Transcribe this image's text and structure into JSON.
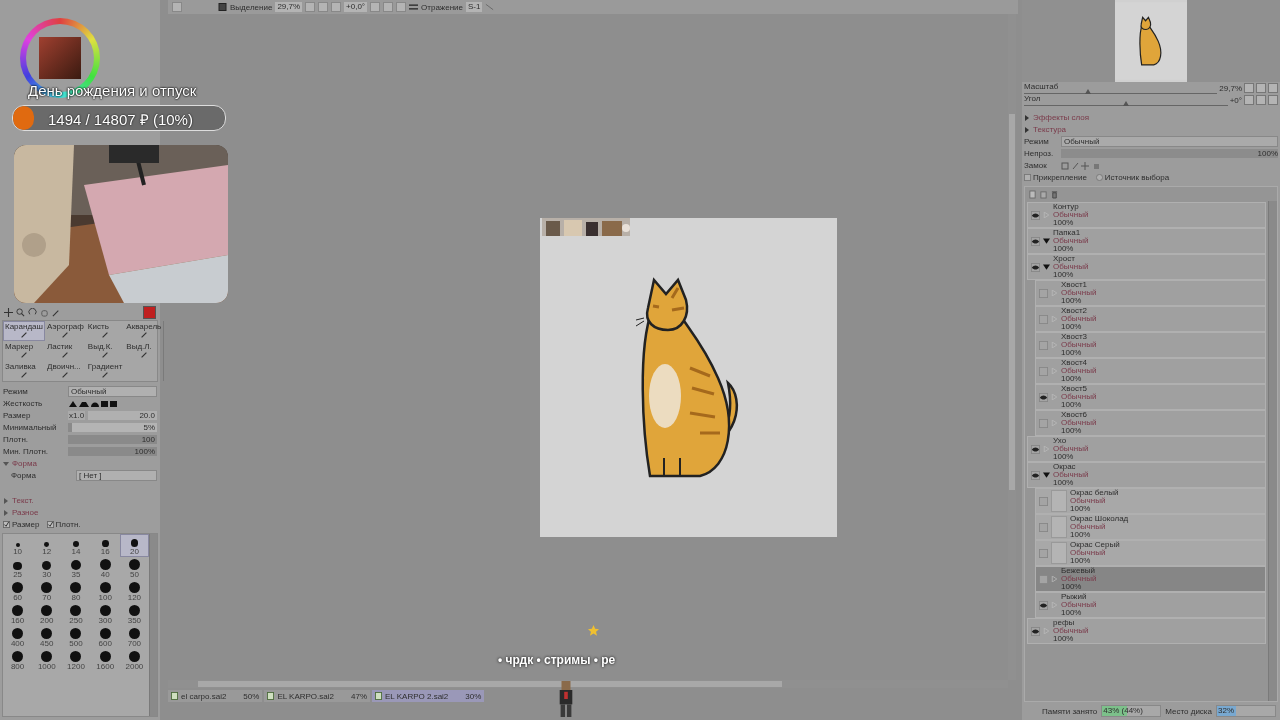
{
  "overlay": {
    "goal_title": "День рождения и отпуск",
    "goal_amount": "1494 / 14807 ₽ (10%)",
    "goal_progress": {
      "level": 0.1
    },
    "caption": "• чрдк • стримы • ре"
  },
  "toolbar": {
    "selection_checked": true,
    "selection_label": "Выделение",
    "zoom": "29,7%",
    "angle": "+0,0°",
    "mirror_label": "Отражение",
    "stabilizer": "S-1"
  },
  "tools": [
    {
      "label": "Карандаш",
      "selected": true
    },
    {
      "label": "Аэрограф",
      "selected": false
    },
    {
      "label": "Кисть",
      "selected": false
    },
    {
      "label": "Акварель",
      "selected": false
    },
    {
      "label": "Маркер",
      "selected": false
    },
    {
      "label": "Ластик",
      "selected": false
    },
    {
      "label": "Выд.К.",
      "selected": false
    },
    {
      "label": "Выд.Л.",
      "selected": false
    },
    {
      "label": "Заливка",
      "selected": false
    },
    {
      "label": "Двоичн...",
      "selected": false
    },
    {
      "label": "Градиент",
      "selected": false
    }
  ],
  "brush_settings": {
    "mode_label": "Режим",
    "mode": "Обычный",
    "hardness_label": "Жесткость",
    "size_label": "Размер",
    "size_multiplier": "x1.0",
    "size": "20.0",
    "min_size_label": "Минимальный",
    "min_size": {
      "reading": "5%",
      "level": 0.05
    },
    "density_label": "Плотн.",
    "density": {
      "reading": "100",
      "level": 1
    },
    "min_density_label": "Мин. Плотн.",
    "min_density": {
      "reading": "100%",
      "level": 1
    },
    "shape_section": "Форма",
    "shape_label": "Форма",
    "shape": "[ Нет ]",
    "texture_section": "Текст.",
    "misc_section": "Разное",
    "checks": [
      {
        "label": "Размер",
        "checked": true
      },
      {
        "label": "Плотн.",
        "checked": true
      }
    ]
  },
  "brush_sizes": [
    {
      "label": "10",
      "selected": false
    },
    {
      "label": "12",
      "selected": false
    },
    {
      "label": "14",
      "selected": false
    },
    {
      "label": "16",
      "selected": false
    },
    {
      "label": "20",
      "selected": true
    },
    {
      "label": "25",
      "selected": false
    },
    {
      "label": "30",
      "selected": false
    },
    {
      "label": "35",
      "selected": false
    },
    {
      "label": "40",
      "selected": false
    },
    {
      "label": "50",
      "selected": false
    },
    {
      "label": "60",
      "selected": false
    },
    {
      "label": "70",
      "selected": false
    },
    {
      "label": "80",
      "selected": false
    },
    {
      "label": "100",
      "selected": false
    },
    {
      "label": "120",
      "selected": false
    },
    {
      "label": "160",
      "selected": false
    },
    {
      "label": "200",
      "selected": false
    },
    {
      "label": "250",
      "selected": false
    },
    {
      "label": "300",
      "selected": false
    },
    {
      "label": "350",
      "selected": false
    },
    {
      "label": "400",
      "selected": false
    },
    {
      "label": "450",
      "selected": false
    },
    {
      "label": "500",
      "selected": false
    },
    {
      "label": "600",
      "selected": false
    },
    {
      "label": "700",
      "selected": false
    },
    {
      "label": "800",
      "selected": false
    },
    {
      "label": "1000",
      "selected": false
    },
    {
      "label": "1200",
      "selected": false
    },
    {
      "label": "1600",
      "selected": false
    },
    {
      "label": "2000",
      "selected": false
    }
  ],
  "document_tabs": [
    {
      "name": "el carpo.sai2",
      "zoom": "50%",
      "selected": false
    },
    {
      "name": "EL KARPO.sai2",
      "zoom": "47%",
      "selected": false
    },
    {
      "name": "EL KARPO 2.sai2",
      "zoom": "30%",
      "selected": true
    }
  ],
  "navigator": {
    "zoom_label": "Масштаб",
    "zoom": "29,7%",
    "zoom_slider": {
      "level": 0.33
    },
    "angle_label": "Угол",
    "angle": "+0°",
    "angle_slider": {
      "level": 0.5
    }
  },
  "layer_panel": {
    "effects": "Эффекты слоя",
    "texture": "Текстура",
    "mode_label": "Режим",
    "mode": "Обычный",
    "opacity_label": "Непроз.",
    "opacity": {
      "reading": "100%",
      "level": 1
    },
    "lock_label": "Замок",
    "clip_label": "Прикрепление",
    "clip": false,
    "source_label": "Источник выбора",
    "source": false
  },
  "layers": [
    {
      "name": "Контур",
      "mode": "Обычный",
      "opacity": "100%",
      "kind": "layer",
      "visible": true,
      "selected": false
    },
    {
      "name": "Папка1",
      "mode": "Обычный",
      "opacity": "100%",
      "kind": "folder",
      "visible": true,
      "selected": false
    },
    {
      "name": "Хрост",
      "mode": "Обычный",
      "opacity": "100%",
      "kind": "folder",
      "visible": true,
      "selected": false,
      "children": [
        {
          "name": "Хвост1",
          "mode": "Обычный",
          "opacity": "100%",
          "kind": "layer",
          "visible": false,
          "selected": false
        },
        {
          "name": "Хвост2",
          "mode": "Обычный",
          "opacity": "100%",
          "kind": "layer",
          "visible": false,
          "selected": false
        },
        {
          "name": "Хвост3",
          "mode": "Обычный",
          "opacity": "100%",
          "kind": "layer",
          "visible": false,
          "selected": false
        },
        {
          "name": "Хвост4",
          "mode": "Обычный",
          "opacity": "100%",
          "kind": "layer",
          "visible": false,
          "selected": false
        },
        {
          "name": "Хвост5",
          "mode": "Обычный",
          "opacity": "100%",
          "kind": "layer",
          "visible": true,
          "selected": false
        },
        {
          "name": "Хвост6",
          "mode": "Обычный",
          "opacity": "100%",
          "kind": "layer",
          "visible": false,
          "selected": false
        }
      ]
    },
    {
      "name": "Ухо",
      "mode": "Обычный",
      "opacity": "100%",
      "kind": "layer",
      "visible": true,
      "selected": false
    },
    {
      "name": "Окрас",
      "mode": "Обычный",
      "opacity": "100%",
      "kind": "folder",
      "visible": true,
      "selected": false,
      "children": [
        {
          "name": "Окрас белый",
          "mode": "Обычный",
          "opacity": "100%",
          "visible": false,
          "selected": false
        },
        {
          "name": "Окрас Шоколад",
          "mode": "Обычный",
          "opacity": "100%",
          "visible": false,
          "selected": false
        },
        {
          "name": "Окрас Серый",
          "mode": "Обычный",
          "opacity": "100%",
          "visible": false,
          "selected": false
        },
        {
          "name": "Бежевый",
          "mode": "Обычный",
          "opacity": "100%",
          "kind": "layer",
          "visible": false,
          "selected": true
        },
        {
          "name": "Рыжий",
          "mode": "Обычный",
          "opacity": "100%",
          "kind": "layer",
          "visible": true,
          "selected": false
        }
      ]
    },
    {
      "name": "рефы",
      "mode": "Обычный",
      "opacity": "100%",
      "kind": "layer",
      "visible": true,
      "selected": false
    }
  ],
  "status_bar": {
    "memory_label": "Памяти занято",
    "memory": {
      "reading": "43% (44%)",
      "level": 0.43
    },
    "disk_label": "Место диска",
    "disk": {
      "reading": "32%",
      "level": 0.32
    }
  }
}
